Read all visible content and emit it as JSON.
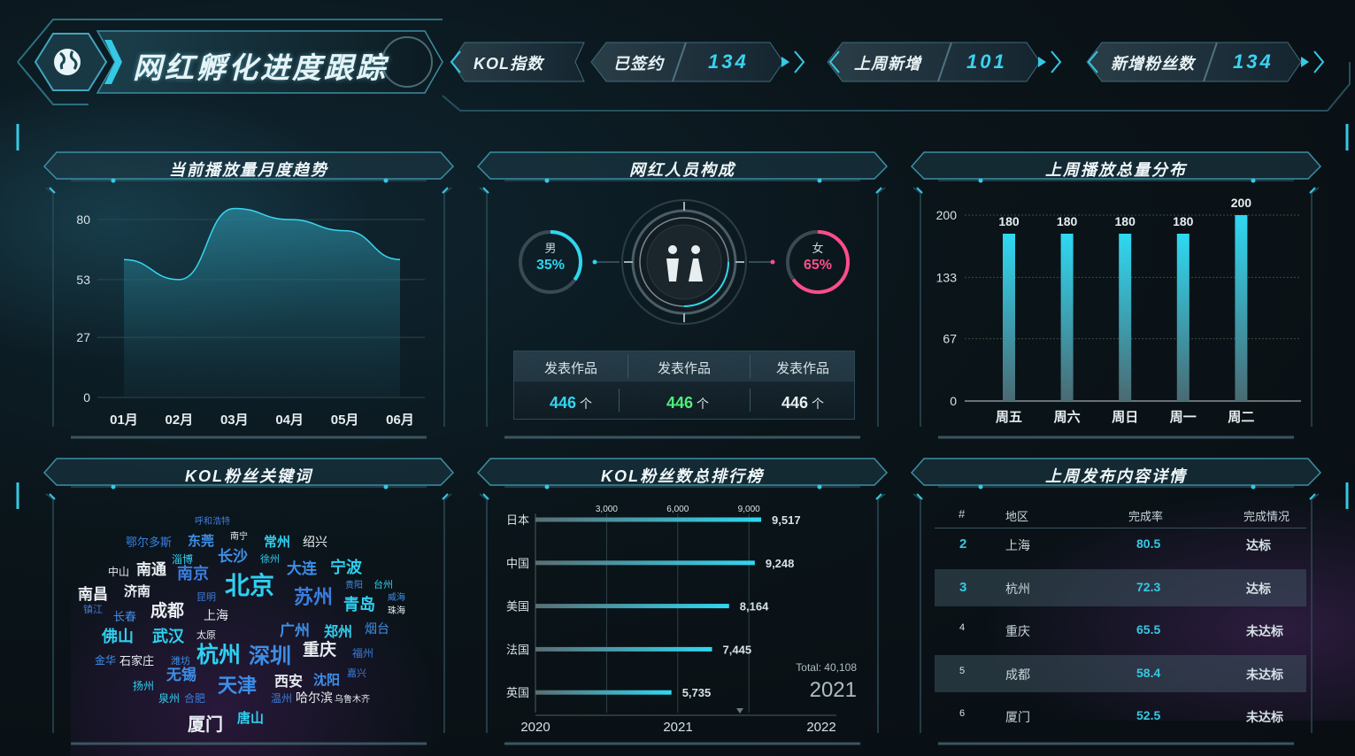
{
  "header": {
    "title": "网红孵化进度跟踪",
    "kpis": [
      {
        "label": "KOL指数",
        "value": ""
      },
      {
        "label": "已签约",
        "value": "134"
      },
      {
        "label": "上周新增",
        "value": "101"
      },
      {
        "label": "新增粉丝数",
        "value": "134"
      }
    ]
  },
  "panels": {
    "trend": {
      "title": "当前播放量月度趋势"
    },
    "composition": {
      "title": "网红人员构成"
    },
    "weekly": {
      "title": "上周播放总量分布"
    },
    "keywords": {
      "title": "KOL粉丝关键词"
    },
    "ranking": {
      "title": "KOL粉丝数总排行榜"
    },
    "details": {
      "title": "上周发布内容详情"
    }
  },
  "gender": {
    "male_label": "男",
    "male_pct": "35%",
    "male_color": "#2fd6ee",
    "female_label": "女",
    "female_pct": "65%",
    "female_color": "#ff4d8a"
  },
  "works": {
    "headers": [
      "发表作品",
      "发表作品",
      "发表作品"
    ],
    "values": [
      "446",
      "446",
      "446"
    ],
    "unit": "个",
    "colors": [
      "#35d4f0",
      "#4df07a",
      "#e6eef0"
    ]
  },
  "chart_data": [
    {
      "type": "area",
      "title": "当前播放量月度趋势",
      "categories": [
        "01月",
        "02月",
        "03月",
        "04月",
        "05月",
        "06月"
      ],
      "values": [
        62,
        53,
        85,
        80,
        75,
        62
      ],
      "yticks": [
        0,
        27,
        53,
        80
      ],
      "ylim": [
        0,
        80
      ]
    },
    {
      "type": "bar",
      "title": "上周播放总量分布",
      "categories": [
        "周五",
        "周六",
        "周日",
        "周一",
        "周二"
      ],
      "values": [
        180,
        180,
        180,
        180,
        200
      ],
      "yticks": [
        0,
        67,
        133,
        200
      ],
      "ylim": [
        0,
        200
      ]
    },
    {
      "type": "bar",
      "orientation": "horizontal",
      "title": "KOL粉丝数总排行榜",
      "categories": [
        "日本",
        "中国",
        "美国",
        "法国",
        "英国"
      ],
      "values": [
        9517,
        9248,
        8164,
        7445,
        5735
      ],
      "value_labels": [
        "9,517",
        "9,248",
        "8,164",
        "7,445",
        "5,735"
      ],
      "xticks": [
        "3,000",
        "6,000",
        "9,000"
      ],
      "timeline": [
        "2020",
        "2021",
        "2022"
      ],
      "total_label": "Total: 40,108",
      "year": "2021"
    }
  ],
  "keywords": [
    {
      "t": "呼和浩特",
      "s": 10,
      "c": "#3d7bd9"
    },
    {
      "t": "鄂尔多斯",
      "s": 13,
      "c": "#3a7fe0"
    },
    {
      "t": "东莞",
      "s": 15,
      "c": "#3d8fe8"
    },
    {
      "t": "南宁",
      "s": 10,
      "c": "#e8eef2"
    },
    {
      "t": "常州",
      "s": 15,
      "c": "#2fd0f0"
    },
    {
      "t": "绍兴",
      "s": 14,
      "c": "#e8eef2"
    },
    {
      "t": "淄博",
      "s": 12,
      "c": "#2fd0f0"
    },
    {
      "t": "长沙",
      "s": 17,
      "c": "#3d8fe8"
    },
    {
      "t": "徐州",
      "s": 11,
      "c": "#2fd0f0"
    },
    {
      "t": "中山",
      "s": 12,
      "c": "#e8eef2"
    },
    {
      "t": "南通",
      "s": 17,
      "c": "#e8eef2"
    },
    {
      "t": "南京",
      "s": 18,
      "c": "#3a7fe0"
    },
    {
      "t": "北京",
      "s": 28,
      "c": "#2fd0f0"
    },
    {
      "t": "大连",
      "s": 17,
      "c": "#3d8fe8"
    },
    {
      "t": "宁波",
      "s": 18,
      "c": "#2fd0f0"
    },
    {
      "t": "南昌",
      "s": 17,
      "c": "#e8eef2"
    },
    {
      "t": "济南",
      "s": 15,
      "c": "#e8eef2"
    },
    {
      "t": "昆明",
      "s": 11,
      "c": "#3d7bd9"
    },
    {
      "t": "苏州",
      "s": 22,
      "c": "#3a7fe0"
    },
    {
      "t": "贵阳",
      "s": 10,
      "c": "#3d8fe8"
    },
    {
      "t": "台州",
      "s": 11,
      "c": "#2fd0f0"
    },
    {
      "t": "威海",
      "s": 10,
      "c": "#3d8fe8"
    },
    {
      "t": "珠海",
      "s": 10,
      "c": "#e8eef2"
    },
    {
      "t": "镇江",
      "s": 11,
      "c": "#3d7bd9"
    },
    {
      "t": "长春",
      "s": 13,
      "c": "#3d8fe8"
    },
    {
      "t": "成都",
      "s": 19,
      "c": "#e8eef2"
    },
    {
      "t": "上海",
      "s": 14,
      "c": "#e8eef2"
    },
    {
      "t": "青岛",
      "s": 18,
      "c": "#2fd0f0"
    },
    {
      "t": "佛山",
      "s": 18,
      "c": "#2fd0f0"
    },
    {
      "t": "武汉",
      "s": 18,
      "c": "#2fd0f0"
    },
    {
      "t": "太原",
      "s": 11,
      "c": "#e8eef2"
    },
    {
      "t": "广州",
      "s": 17,
      "c": "#3d8fe8"
    },
    {
      "t": "郑州",
      "s": 16,
      "c": "#2fd0f0"
    },
    {
      "t": "烟台",
      "s": 14,
      "c": "#3d8fe8"
    },
    {
      "t": "金华",
      "s": 12,
      "c": "#3d8fe8"
    },
    {
      "t": "石家庄",
      "s": 13,
      "c": "#e8eef2"
    },
    {
      "t": "潍坊",
      "s": 11,
      "c": "#3d8fe8"
    },
    {
      "t": "杭州",
      "s": 25,
      "c": "#2fd0f0"
    },
    {
      "t": "深圳",
      "s": 24,
      "c": "#3d8fe8"
    },
    {
      "t": "重庆",
      "s": 19,
      "c": "#e8eef2"
    },
    {
      "t": "福州",
      "s": 12,
      "c": "#3d7bd9"
    },
    {
      "t": "无锡",
      "s": 17,
      "c": "#3d8fe8"
    },
    {
      "t": "嘉兴",
      "s": 11,
      "c": "#3d7bd9"
    },
    {
      "t": "扬州",
      "s": 12,
      "c": "#2fd0f0"
    },
    {
      "t": "天津",
      "s": 22,
      "c": "#3d8fe8"
    },
    {
      "t": "西安",
      "s": 16,
      "c": "#e8eef2"
    },
    {
      "t": "沈阳",
      "s": 15,
      "c": "#3d8fe8"
    },
    {
      "t": "泉州",
      "s": 12,
      "c": "#2fd0f0"
    },
    {
      "t": "合肥",
      "s": 12,
      "c": "#3d7bd9"
    },
    {
      "t": "温州",
      "s": 12,
      "c": "#3d7bd9"
    },
    {
      "t": "哈尔滨",
      "s": 14,
      "c": "#e8eef2"
    },
    {
      "t": "乌鲁木齐",
      "s": 10,
      "c": "#e8eef2"
    },
    {
      "t": "厦门",
      "s": 20,
      "c": "#e8eef2"
    },
    {
      "t": "唐山",
      "s": 15,
      "c": "#2fd0f0"
    }
  ],
  "details": {
    "headers": [
      "#",
      "地区",
      "完成率",
      "完成情况"
    ],
    "rows": [
      {
        "rank": "2",
        "region": "上海",
        "rate": "80.5",
        "status": "达标"
      },
      {
        "rank": "3",
        "region": "杭州",
        "rate": "72.3",
        "status": "达标"
      },
      {
        "rank": "4",
        "region": "重庆",
        "rate": "65.5",
        "status": "未达标"
      },
      {
        "rank": "5",
        "region": "成都",
        "rate": "58.4",
        "status": "未达标"
      },
      {
        "rank": "6",
        "region": "厦门",
        "rate": "52.5",
        "status": "未达标"
      }
    ]
  },
  "colors": {
    "accent": "#2fd6ee",
    "female": "#ff4d8a",
    "green": "#4df07a",
    "bg": "#0a1419"
  }
}
